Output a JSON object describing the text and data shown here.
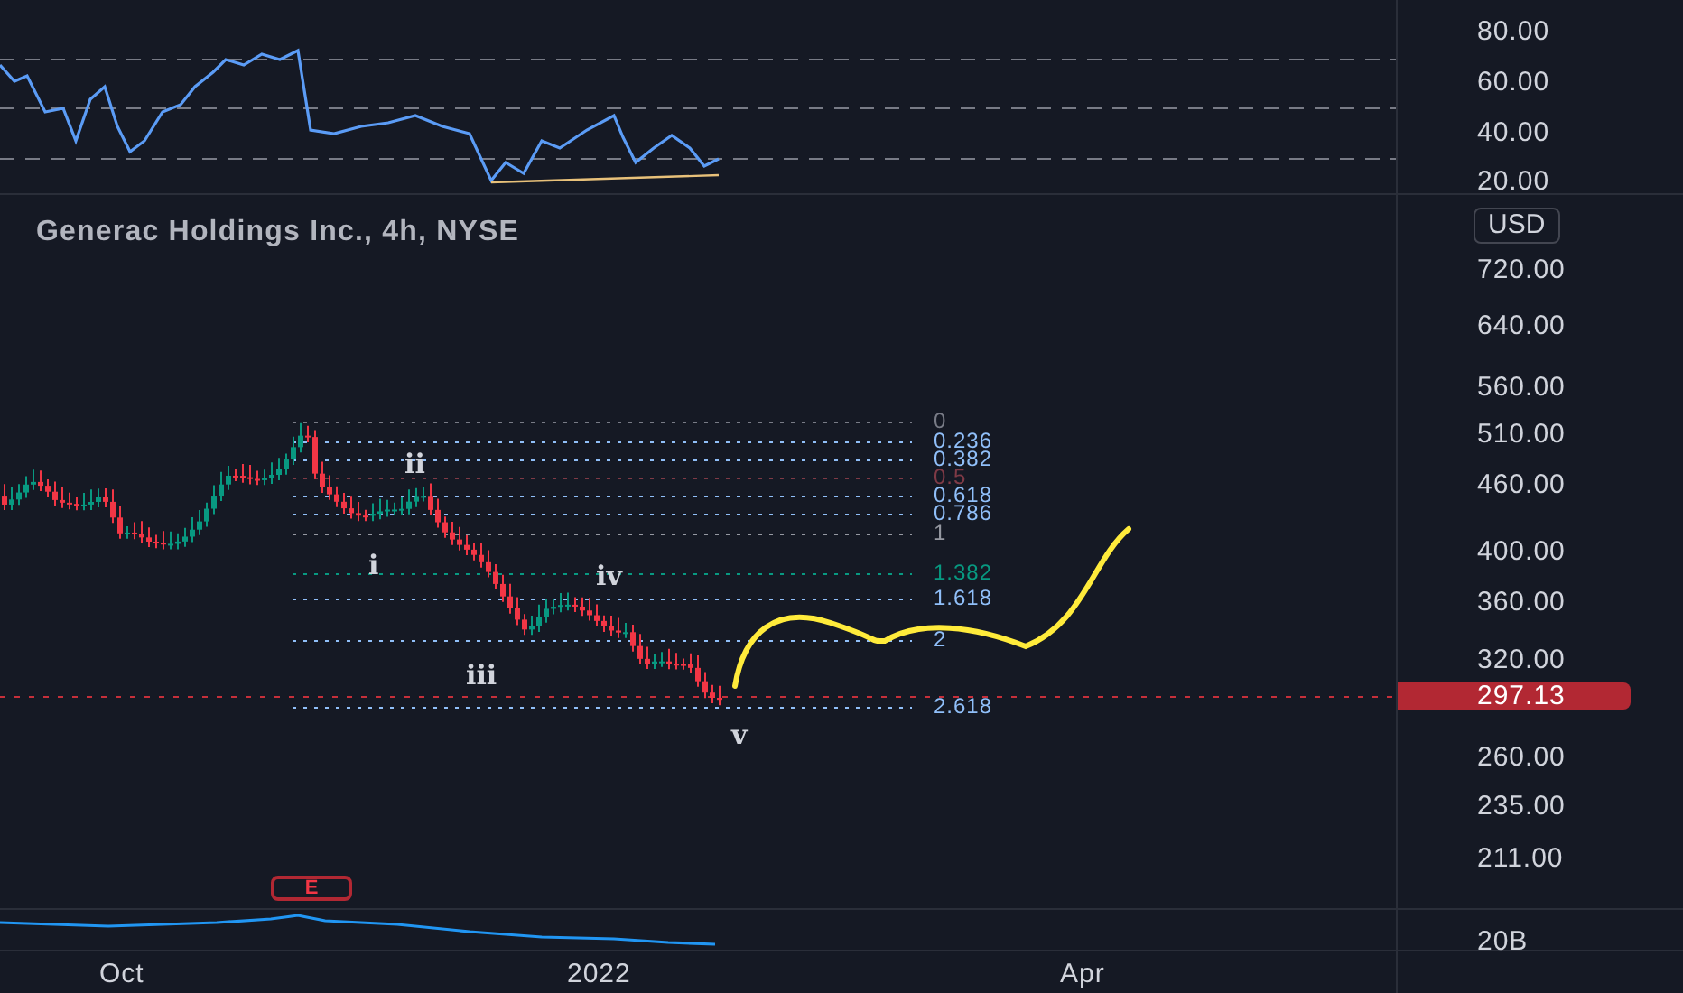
{
  "rsi_pane": {
    "axis_labels": [
      "80.00",
      "60.00",
      "40.00",
      "20.00"
    ]
  },
  "legend": {
    "title": "Generac Holdings Inc., 4h, NYSE",
    "currency": "USD"
  },
  "price_axis": {
    "labels": [
      "720.00",
      "640.00",
      "560.00",
      "510.00",
      "460.00",
      "400.00",
      "360.00",
      "320.00",
      "260.00",
      "235.00",
      "211.00"
    ],
    "last_price": "297.13"
  },
  "fib_levels": [
    {
      "label": "0",
      "color": "#787b86"
    },
    {
      "label": "0.236",
      "color": "#90bff9"
    },
    {
      "label": "0.382",
      "color": "#90bff9"
    },
    {
      "label": "0.5",
      "color": "#7e3a46"
    },
    {
      "label": "0.618",
      "color": "#90bff9"
    },
    {
      "label": "0.786",
      "color": "#90bff9"
    },
    {
      "label": "1",
      "color": "#9598a1"
    },
    {
      "label": "1.382",
      "color": "#089981"
    },
    {
      "label": "1.618",
      "color": "#90bff9"
    },
    {
      "label": "2",
      "color": "#90bff9"
    },
    {
      "label": "2.618",
      "color": "#90bff9"
    }
  ],
  "wave_labels": [
    "ii",
    "i",
    "iv",
    "iii",
    "v"
  ],
  "earnings_marker": "E",
  "volume_axis": {
    "label": "20B"
  },
  "time_axis": [
    "Oct",
    "2022",
    "Apr"
  ]
}
